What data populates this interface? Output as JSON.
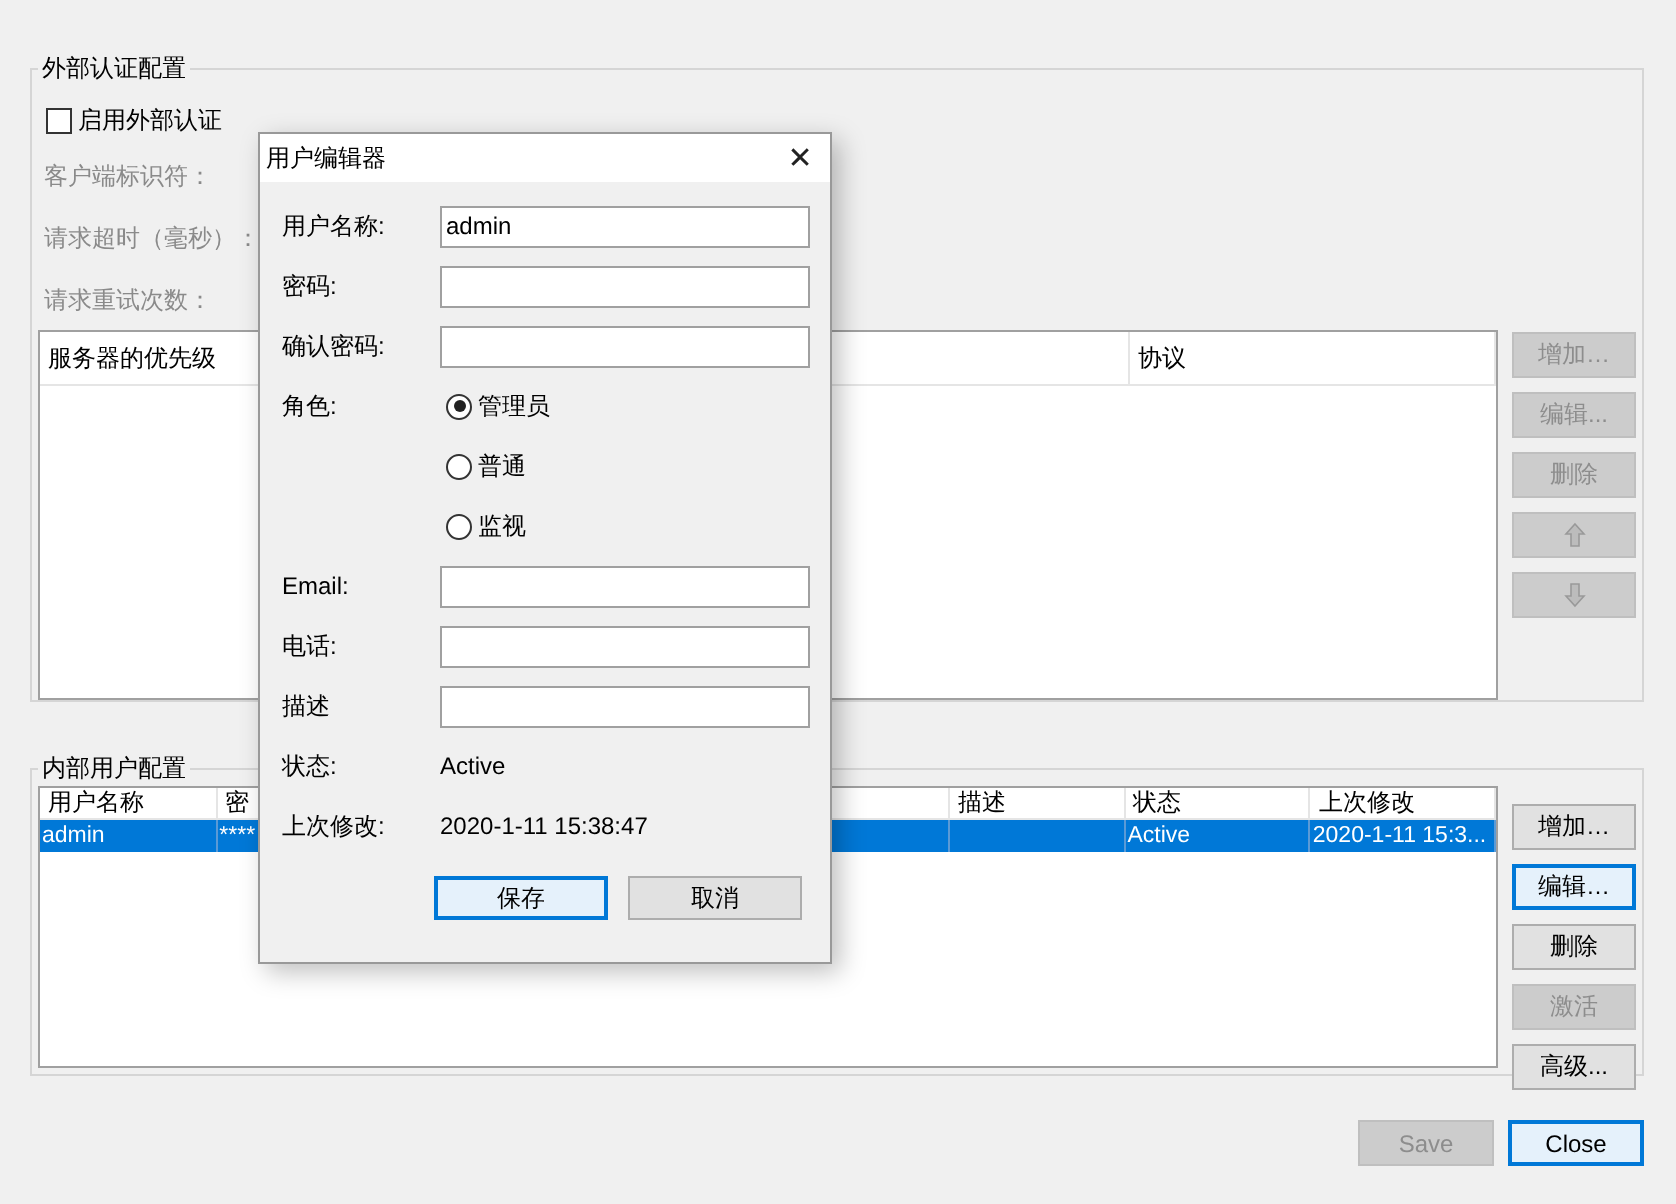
{
  "external_auth": {
    "title": "外部认证配置",
    "enable": {
      "label": "启用外部认证",
      "checked": false
    },
    "fields": [
      {
        "label": "客户端标识符：",
        "disabled": true
      },
      {
        "label": "请求超时（毫秒）：",
        "disabled": true
      },
      {
        "label": "请求重试次数：",
        "disabled": true
      }
    ],
    "table": {
      "columns": [
        {
          "label": "服务器的优先级"
        },
        {
          "label": "协议"
        }
      ]
    },
    "buttons": [
      {
        "kind": "text",
        "label": "增加…",
        "disabled": true
      },
      {
        "kind": "text",
        "label": "编辑...",
        "disabled": true
      },
      {
        "kind": "text",
        "label": "删除",
        "disabled": true
      },
      {
        "kind": "up",
        "disabled": true
      },
      {
        "kind": "down",
        "disabled": true
      }
    ]
  },
  "internal_users": {
    "title": "内部用户配置",
    "table": {
      "columns": [
        {
          "label": "用户名称"
        },
        {
          "label": "密"
        },
        {
          "label": "描述"
        },
        {
          "label": "状态"
        },
        {
          "label": "上次修改"
        }
      ],
      "rows": [
        {
          "selected": true,
          "cells": [
            "admin",
            "****",
            "",
            "Active",
            "2020-1-11 15:3..."
          ]
        }
      ]
    },
    "buttons": [
      {
        "label": "增加…",
        "disabled": false,
        "focused": false
      },
      {
        "label": "编辑…",
        "disabled": false,
        "focused": true
      },
      {
        "label": "删除",
        "disabled": false,
        "focused": false
      },
      {
        "label": "激活",
        "disabled": true,
        "focused": false
      },
      {
        "label": "高级...",
        "disabled": false,
        "focused": false
      }
    ]
  },
  "footer_buttons": [
    {
      "label": "Save",
      "disabled": true,
      "focused": false
    },
    {
      "label": "Close",
      "disabled": false,
      "focused": true
    }
  ],
  "dialog": {
    "title": "用户编辑器",
    "close": "✕",
    "rows": [
      {
        "kind": "input",
        "label": "用户名称:",
        "value": "admin"
      },
      {
        "kind": "input",
        "label": "密码:"
      },
      {
        "kind": "input",
        "label": "确认密码:"
      },
      {
        "kind": "radio",
        "label": "角色:",
        "options": [
          {
            "label": "管理员",
            "selected": true
          },
          {
            "label": "普通",
            "selected": false
          },
          {
            "label": "监视",
            "selected": false
          }
        ]
      },
      {
        "kind": "input",
        "label": "Email:"
      },
      {
        "kind": "input",
        "label": "电话:"
      },
      {
        "kind": "input",
        "label": "描述"
      },
      {
        "kind": "text",
        "label": "状态:",
        "value": "Active"
      },
      {
        "kind": "text",
        "label": "上次修改:",
        "value": "2020-1-11 15:38:47"
      }
    ],
    "buttons": [
      {
        "label": "保存",
        "focused": true
      },
      {
        "label": "取消",
        "focused": false
      }
    ]
  }
}
